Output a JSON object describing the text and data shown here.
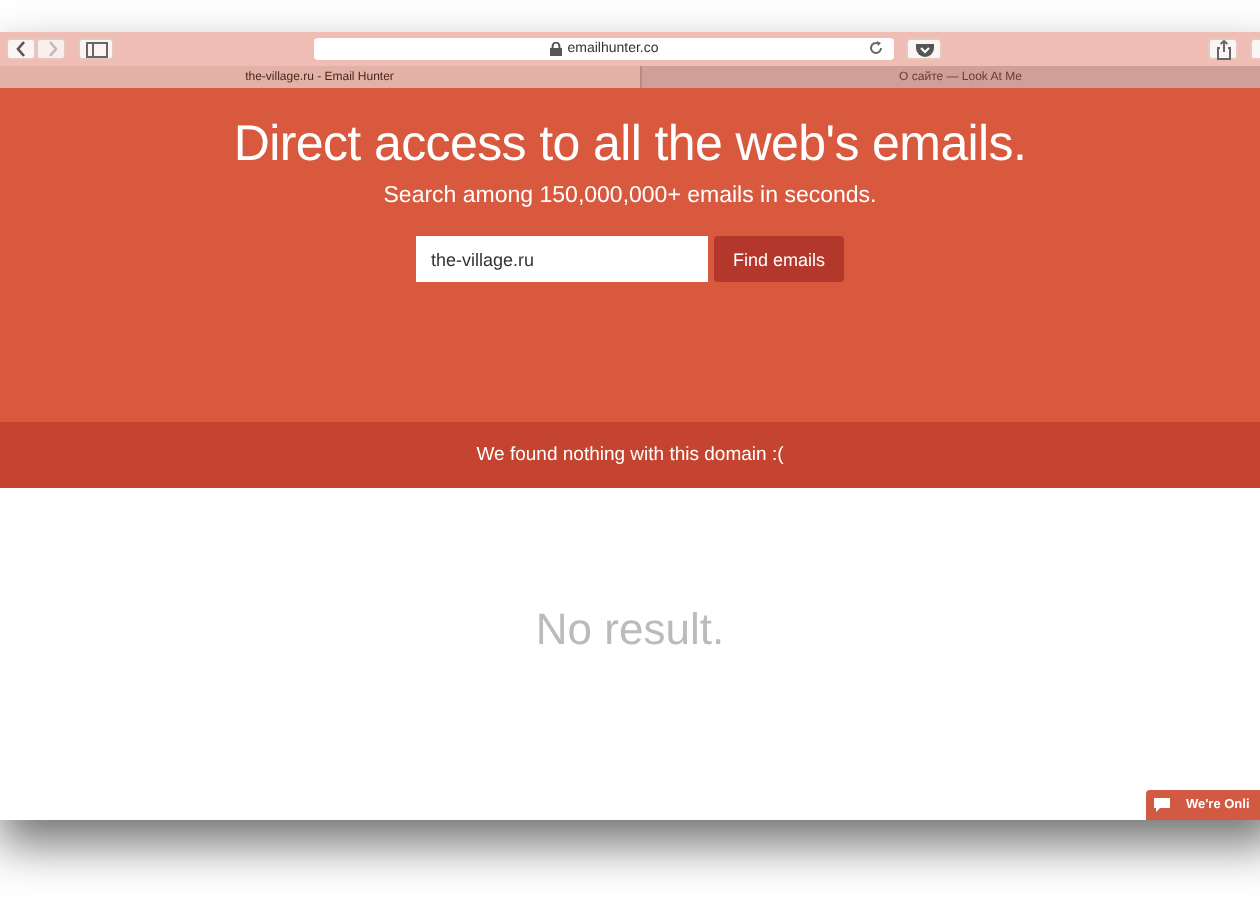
{
  "browser": {
    "url": "emailhunter.co",
    "tabs": [
      {
        "label": "the-village.ru - Email Hunter",
        "selected": true
      },
      {
        "label": "О сайте — Look At Me",
        "selected": false
      }
    ]
  },
  "hero": {
    "title": "Direct access to all the web's emails.",
    "subtitle": "Search among 150,000,000+ emails in seconds.",
    "search": {
      "value": "the-village.ru"
    },
    "button": "Find emails"
  },
  "banner": "We found nothing with this domain :(",
  "result": "No result.",
  "chat_widget": {
    "label": "We're Onli"
  }
}
